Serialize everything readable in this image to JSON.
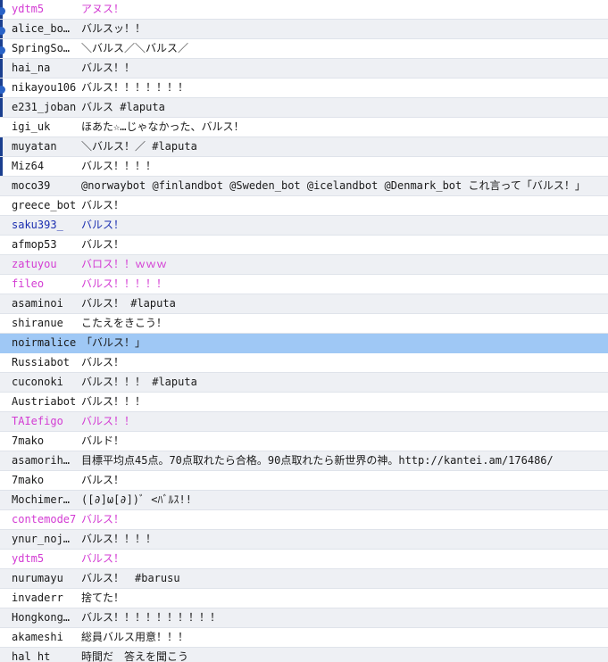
{
  "colors": {
    "normal": "#1a1a1a",
    "pink": "#d33bd3",
    "blue": "#1c2fb0",
    "selected_bg": "#9fc8f5",
    "alt_bg": "#eef0f4"
  },
  "icons": {
    "reply": "reply-indicator-icon",
    "row_mark": "row-marker"
  },
  "tweets": [
    {
      "user": "ydtm5",
      "text": "アヌス！",
      "color": "pink",
      "mark": true,
      "reply": true
    },
    {
      "user": "alice_bo…",
      "text": "バルスッ！！",
      "color": "normal",
      "mark": true,
      "reply": true
    },
    {
      "user": "SpringSo…",
      "text": "＼バルス／＼バルス／",
      "color": "normal",
      "mark": true,
      "reply": true
    },
    {
      "user": "hai_na",
      "text": "バルス！！",
      "color": "normal",
      "mark": true
    },
    {
      "user": "nikayou106",
      "text": "バルス！！！！！！！",
      "color": "normal",
      "mark": true,
      "reply": true
    },
    {
      "user": "e231_joban",
      "text": "バルス #laputa",
      "color": "normal",
      "mark": true
    },
    {
      "user": "igi_uk",
      "text": "ほあた☆…じゃなかった、バルス！",
      "color": "normal"
    },
    {
      "user": "muyatan",
      "text": "＼バルス！／ #laputa",
      "color": "normal",
      "mark": true
    },
    {
      "user": "Miz64",
      "text": "バルス！！！！",
      "color": "normal",
      "mark": true
    },
    {
      "user": "moco39",
      "text": "@norwaybot @finlandbot @Sweden_bot @icelandbot @Denmark_bot これ言って「バルス！」",
      "color": "normal"
    },
    {
      "user": "greece_bot",
      "text": "バルス！",
      "color": "normal"
    },
    {
      "user": "saku393_",
      "text": "バルス！",
      "color": "blue"
    },
    {
      "user": "afmop53",
      "text": "バルス！",
      "color": "normal"
    },
    {
      "user": "zatuyou",
      "text": "バロス！！ｗｗｗ",
      "color": "pink"
    },
    {
      "user": "fileo",
      "text": "バルス！！！！！",
      "color": "pink"
    },
    {
      "user": "asaminoi",
      "text": "バルス！ #laputa",
      "color": "normal"
    },
    {
      "user": "shiranue",
      "text": "こたえをきこう！",
      "color": "normal"
    },
    {
      "user": "noirmalice",
      "text": "「バルス！」",
      "color": "normal",
      "selected": true
    },
    {
      "user": "Russiabot",
      "text": "バルス！",
      "color": "normal"
    },
    {
      "user": "cuconoki",
      "text": "バルス！！！ #laputa",
      "color": "normal"
    },
    {
      "user": "Austriabot",
      "text": "バルス！！！",
      "color": "normal"
    },
    {
      "user": "TAIefigo",
      "text": "バルス！！",
      "color": "pink"
    },
    {
      "user": "7mako",
      "text": "バルド！",
      "color": "normal"
    },
    {
      "user": "asamorih…",
      "text": "目標平均点45点。70点取れたら合格。90点取れたら新世界の神。http://kantei.am/176486/",
      "color": "normal"
    },
    {
      "user": "7mako",
      "text": "バルス！",
      "color": "normal"
    },
    {
      "user": "Mochimer…",
      "text": "([∂]ω[∂])ﾞ <ﾊﾞﾙｽ!!",
      "color": "normal"
    },
    {
      "user": "contemode7",
      "text": "バルス！",
      "color": "pink"
    },
    {
      "user": "ynur_noj…",
      "text": "バルス！！！！",
      "color": "normal"
    },
    {
      "user": "ydtm5",
      "text": "バルス！",
      "color": "pink"
    },
    {
      "user": "nurumayu",
      "text": "バルス！　#barusu",
      "color": "normal"
    },
    {
      "user": "invaderr",
      "text": "捨てた！",
      "color": "normal"
    },
    {
      "user": "Hongkong…",
      "text": "バルス！！！！！！！！！！",
      "color": "normal"
    },
    {
      "user": "akameshi",
      "text": "総員バルス用意！！！",
      "color": "normal"
    },
    {
      "user": "hal_ht",
      "text": "時間だ　答えを聞こう",
      "color": "normal"
    }
  ]
}
